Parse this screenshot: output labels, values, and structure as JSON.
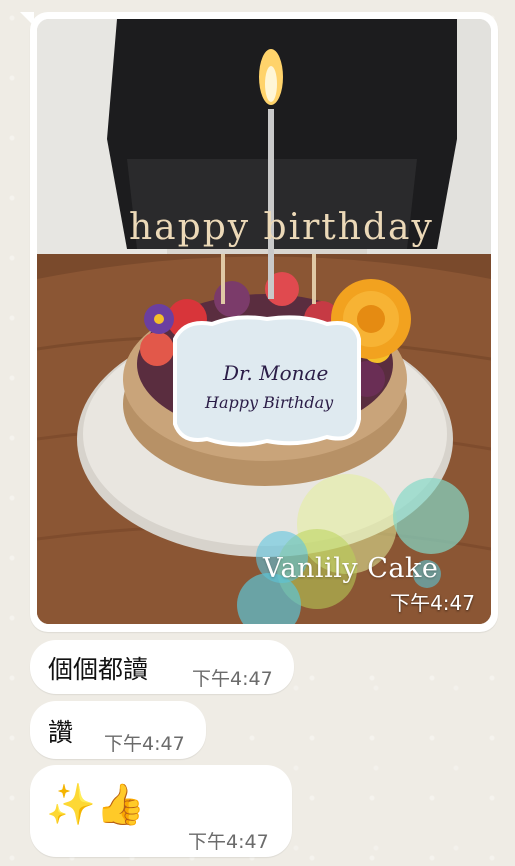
{
  "photo_message": {
    "watermark": "Vanlily Cake",
    "cake_topper": "happy birthday",
    "plaque_line1": "Dr. Monae",
    "plaque_line2": "Happy Birthday",
    "time": "下午4:47"
  },
  "messages": [
    {
      "text": "個個都讀",
      "time": "下午4:47"
    },
    {
      "text": "讚",
      "time": "下午4:47"
    },
    {
      "text": "✨👍",
      "time": "下午4:47"
    }
  ],
  "colors": {
    "chat_background": "#efece5",
    "bubble": "#ffffff",
    "time_text": "#6b6b6b"
  }
}
